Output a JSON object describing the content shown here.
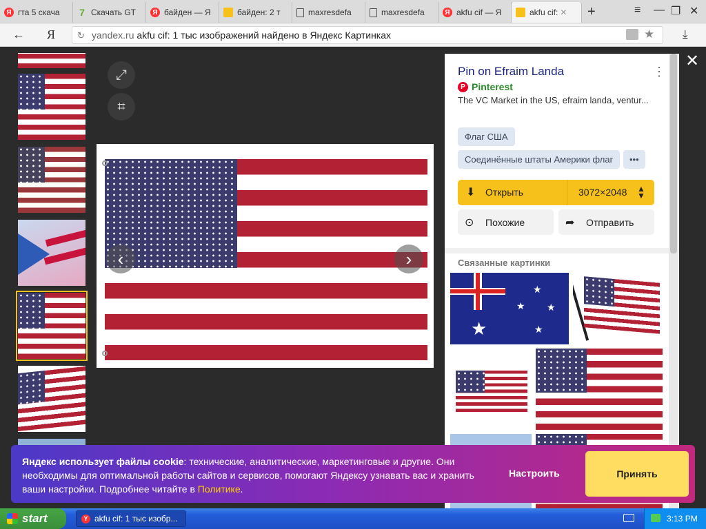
{
  "tabs": [
    {
      "label": "гта 5 скача",
      "icon": "yandex-icon"
    },
    {
      "label": "Скачать GT",
      "icon": "seven-icon"
    },
    {
      "label": "байден — Я",
      "icon": "yandex-icon"
    },
    {
      "label": "байден: 2 т",
      "icon": "image-search-icon"
    },
    {
      "label": "maxresdefa",
      "icon": "document-icon"
    },
    {
      "label": "maxresdefa",
      "icon": "document-icon"
    },
    {
      "label": "akfu cif — Я",
      "icon": "yandex-icon"
    },
    {
      "label": "akfu cif:",
      "icon": "image-search-icon",
      "active": true
    }
  ],
  "browser": {
    "logo": "Я",
    "url_domain": "yandex.ru",
    "url_title": "akfu cif: 1 тыс изображений найдено в Яндекс Картинках",
    "window_buttons": [
      "≡",
      "—",
      "❐",
      "✕"
    ]
  },
  "panel": {
    "title": "Pin on Efraim Landa",
    "source": "Pinterest",
    "description": "The VC Market in the US, efraim landa, ventur...",
    "tags": [
      "Флаг США",
      "Соединённые штаты Америки флаг",
      "•••"
    ],
    "open_label": "Открыть",
    "image_size": "3072×2048",
    "similar_label": "Похожие",
    "share_label": "Отправить",
    "related_title": "Связанные картинки"
  },
  "cookie": {
    "bold": "Яндекс использует файлы cookie",
    "text": ": технические, аналитические, маркетинговые и другие. Они необходимы для оптимальной работы сайтов и сервисов, помогают Яндексу узнавать вас и хранить ваши настройки. Подробнее читайте в ",
    "link": "Политике",
    "after_link": ".",
    "settings_label": "Настроить",
    "accept_label": "Принять"
  },
  "taskbar": {
    "start_label": "start",
    "task_label": "akfu cif: 1 тыс изобр...",
    "clock": "3:13 PM"
  },
  "colors": {
    "accent": "#f7c11b",
    "tag_bg": "#dfe7f2",
    "title": "#1a237e",
    "flag_red": "#b22234",
    "flag_blue": "#3c3b6e"
  }
}
